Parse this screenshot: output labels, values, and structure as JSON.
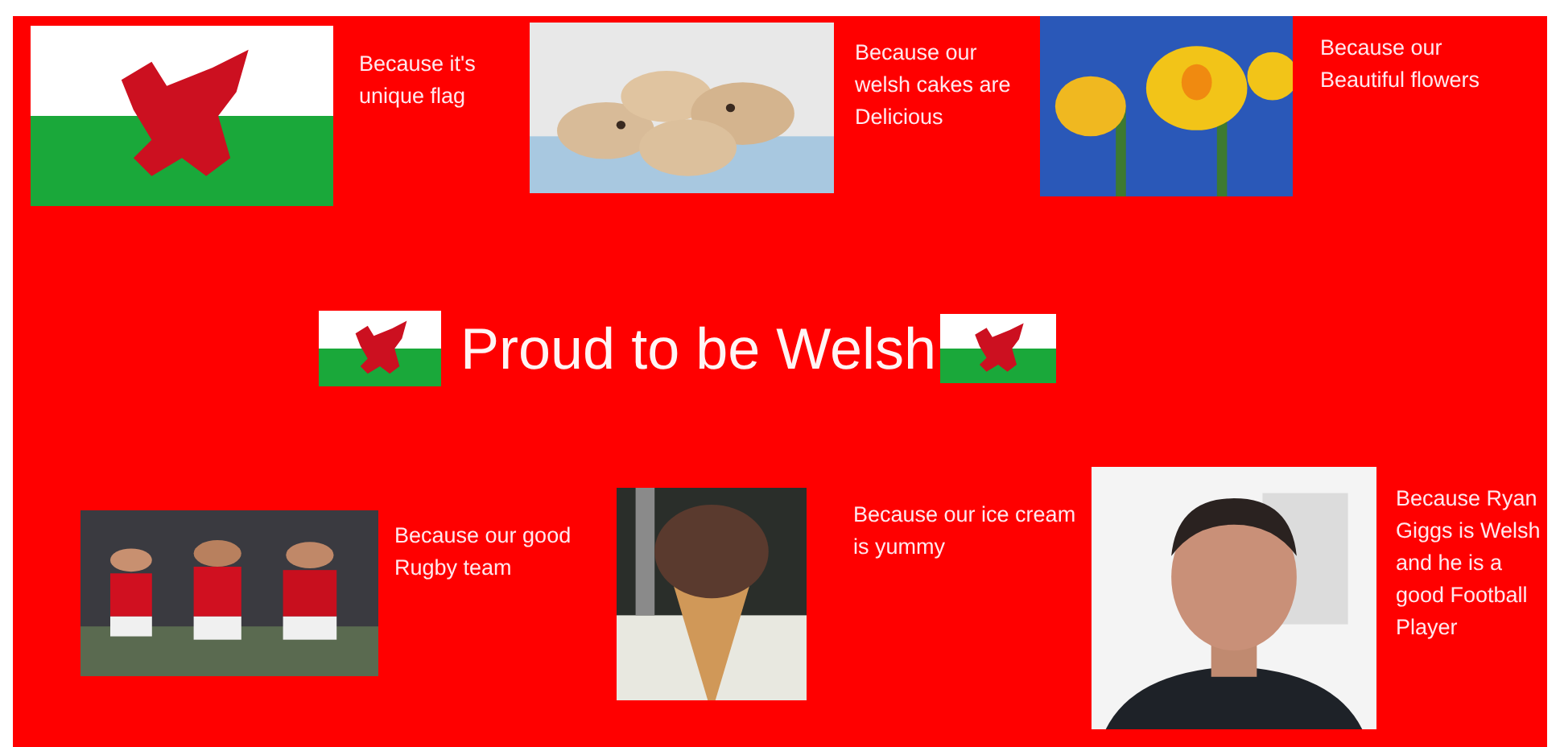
{
  "top_row": [
    {
      "caption": "Because it's unique flag"
    },
    {
      "caption": "Because our welsh cakes are Delicious"
    },
    {
      "caption": "Because our Beautiful flowers"
    }
  ],
  "title": "Proud to be Welsh",
  "bottom_row": [
    {
      "caption": "Because our good Rugby team"
    },
    {
      "caption": "Because our ice cream is yummy"
    },
    {
      "caption": "Because Ryan Giggs is Welsh and he is a good Football Player"
    }
  ]
}
